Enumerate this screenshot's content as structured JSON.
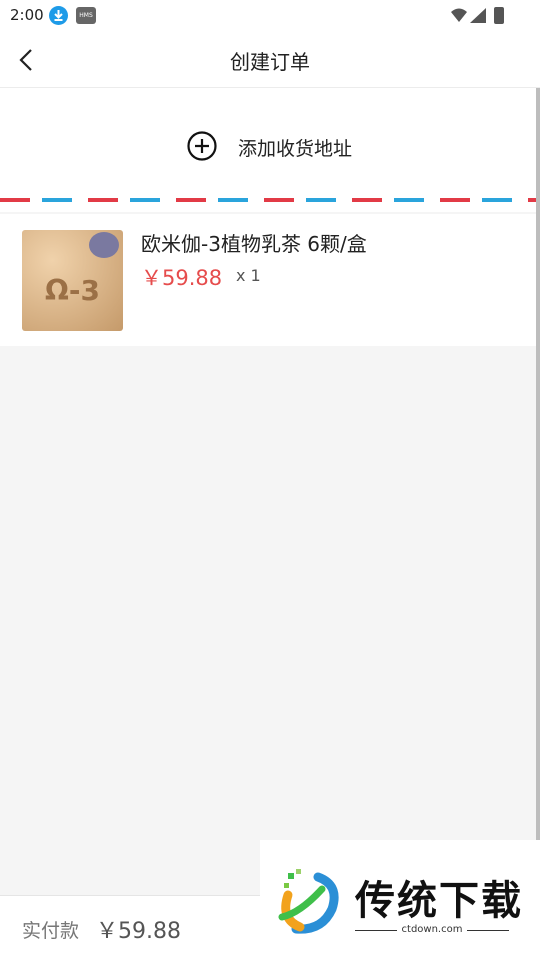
{
  "status_bar": {
    "time": "2:00",
    "hms_badge": "HMS",
    "download_icon": "download-icon"
  },
  "header": {
    "title": "创建订单",
    "back_icon": "chevron-left-icon"
  },
  "address": {
    "add_label": "添加收货地址",
    "add_icon": "plus-circle-icon"
  },
  "order": {
    "product_name": "欧米伽-3植物乳茶 6颗/盒",
    "price": "￥59.88",
    "qty": "x 1",
    "thumb_text": "Ω-3"
  },
  "footer": {
    "total_label": "实付款",
    "total_value": "￥59.88"
  },
  "watermark": {
    "text": "传统下载",
    "site": "ctdown.com"
  },
  "colors": {
    "accent_red": "#e64c4c",
    "stripe_red": "#e23a46",
    "stripe_blue": "#2aa4dc"
  }
}
